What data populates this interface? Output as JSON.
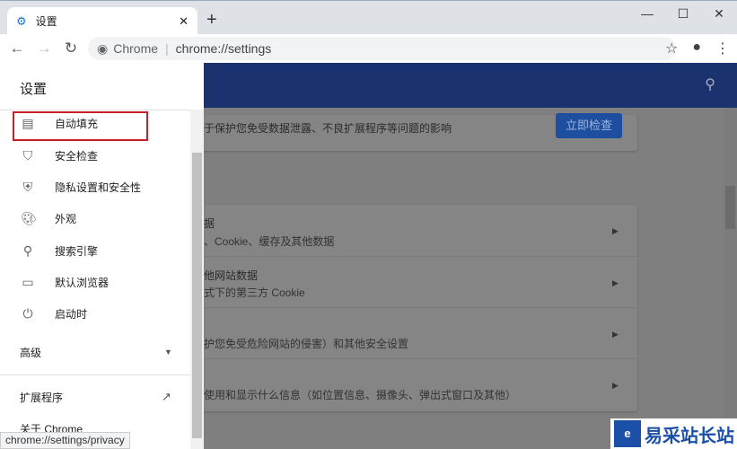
{
  "browser": {
    "tab_title": "设置",
    "address_chip": "Chrome",
    "address_url": "chrome://settings",
    "status_url": "chrome://settings/privacy"
  },
  "sidebar": {
    "title": "设置",
    "items": [
      {
        "label": "自动填充",
        "icon": "assignment-icon"
      },
      {
        "label": "安全检查",
        "icon": "shield-check-icon"
      },
      {
        "label": "隐私设置和安全性",
        "icon": "shield-half-icon",
        "highlighted": true
      },
      {
        "label": "外观",
        "icon": "palette-icon"
      },
      {
        "label": "搜索引擎",
        "icon": "search-icon"
      },
      {
        "label": "默认浏览器",
        "icon": "browser-icon"
      },
      {
        "label": "启动时",
        "icon": "power-icon"
      }
    ],
    "advanced": "高级",
    "extensions": "扩展程序",
    "about": "关于 Chrome"
  },
  "main": {
    "safety_text": "于保护您免受数据泄露、不良扩展程序等问题的影响",
    "check_now": "立即检查",
    "rows": [
      {
        "title": "据",
        "subtitle": "、Cookie、缓存及其他数据"
      },
      {
        "title": "他网站数据",
        "subtitle": "式下的第三方 Cookie"
      },
      {
        "title": "",
        "subtitle": "护您免受危险网站的侵害）和其他安全设置"
      },
      {
        "title": "",
        "subtitle": "使用和显示什么信息（如位置信息、摄像头、弹出式窗口及其他）"
      }
    ]
  },
  "watermark": {
    "text": "易采站长站"
  },
  "colors": {
    "header": "#1a3370",
    "button": "#1e4ea0",
    "highlight": "#c8202a"
  }
}
